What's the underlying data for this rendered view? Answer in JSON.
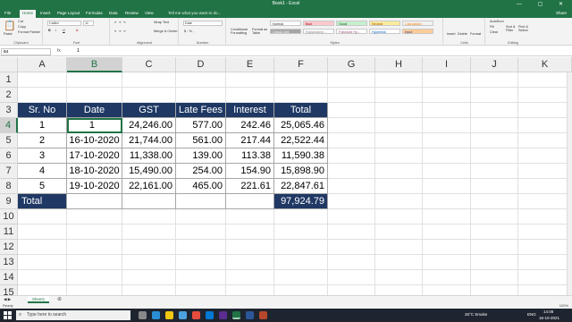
{
  "window": {
    "title": "Book1 - Excel",
    "controls": "— ▢ ✕"
  },
  "tabs": [
    "File",
    "Home",
    "Insert",
    "Page Layout",
    "Formulas",
    "Data",
    "Review",
    "View"
  ],
  "tellme": "Tell me what you want to do...",
  "share": "Share",
  "ribbon": {
    "clipboard": {
      "paste": "Paste",
      "cut": "Cut",
      "copy": "Copy",
      "format_painter": "Format Painter",
      "label": "Clipboard"
    },
    "font": {
      "name": "Calibri",
      "size": "11",
      "label": "Font"
    },
    "alignment": {
      "wrap": "Wrap Text",
      "merge": "Merge & Center",
      "label": "Alignment"
    },
    "number": {
      "format": "Date",
      "label": "Number"
    },
    "styles": {
      "conditional": "Conditional Formatting",
      "format_table": "Format as Table",
      "cells": [
        {
          "label": "Normal",
          "bg": "#ffffff",
          "fg": "#333333"
        },
        {
          "label": "Bad",
          "bg": "#ffc7ce",
          "fg": "#9c0006"
        },
        {
          "label": "Good",
          "bg": "#c6efce",
          "fg": "#006100"
        },
        {
          "label": "Neutral",
          "bg": "#ffeb9c",
          "fg": "#9c5700"
        },
        {
          "label": "Calculation",
          "bg": "#f2f2f2",
          "fg": "#fa7d00"
        },
        {
          "label": "Check Cell",
          "bg": "#a5a5a5",
          "fg": "#ffffff"
        },
        {
          "label": "Explanatory ...",
          "bg": "#ffffff",
          "fg": "#7f7f7f"
        },
        {
          "label": "Followed Hy...",
          "bg": "#ffffff",
          "fg": "#954f72"
        },
        {
          "label": "Hyperlink",
          "bg": "#ffffff",
          "fg": "#0563c1"
        },
        {
          "label": "Input",
          "bg": "#ffcc99",
          "fg": "#3f3f76"
        }
      ],
      "label": "Styles"
    },
    "cells": {
      "insert": "Insert",
      "delete": "Delete",
      "format": "Format",
      "label": "Cells"
    },
    "editing": {
      "autosum": "AutoSum",
      "fill": "Fill",
      "clear": "Clear",
      "sort": "Sort & Filter",
      "find": "Find & Select",
      "label": "Editing"
    }
  },
  "formula_bar": {
    "name_box": "B4",
    "fx": "fx",
    "value": "1"
  },
  "columns": [
    "A",
    "B",
    "C",
    "D",
    "E",
    "F",
    "G",
    "H",
    "I",
    "J",
    "K"
  ],
  "rows": [
    "1",
    "2",
    "3",
    "4",
    "5",
    "6",
    "7",
    "8",
    "9",
    "10",
    "11",
    "12",
    "13",
    "14",
    "15"
  ],
  "table": {
    "headers": [
      "Sr. No",
      "Date",
      "GST",
      "Late Fees",
      "Interest",
      "Total"
    ],
    "data": [
      [
        "1",
        "1",
        "24,246.00",
        "577.00",
        "242.46",
        "25,065.46"
      ],
      [
        "2",
        "16-10-2020",
        "21,744.00",
        "561.00",
        "217.44",
        "22,522.44"
      ],
      [
        "3",
        "17-10-2020",
        "11,338.00",
        "139.00",
        "113.38",
        "11,590.38"
      ],
      [
        "4",
        "18-10-2020",
        "15,490.00",
        "254.00",
        "154.90",
        "15,898.90"
      ],
      [
        "5",
        "19-10-2020",
        "22,161.00",
        "465.00",
        "221.61",
        "22,847.61"
      ]
    ],
    "total_label": "Total",
    "total_value": "97,924.79"
  },
  "sheet": {
    "name": "Sheet1",
    "add": "⊕"
  },
  "status": {
    "ready": "Ready",
    "zoom": "100%"
  },
  "taskbar": {
    "search": "Type here to search",
    "weather": "26°C  Smoke",
    "lang": "ENG",
    "time": "14:08",
    "date": "16-10-2021"
  },
  "colors": {
    "accent": "#217346",
    "table_header": "#1f3864"
  }
}
